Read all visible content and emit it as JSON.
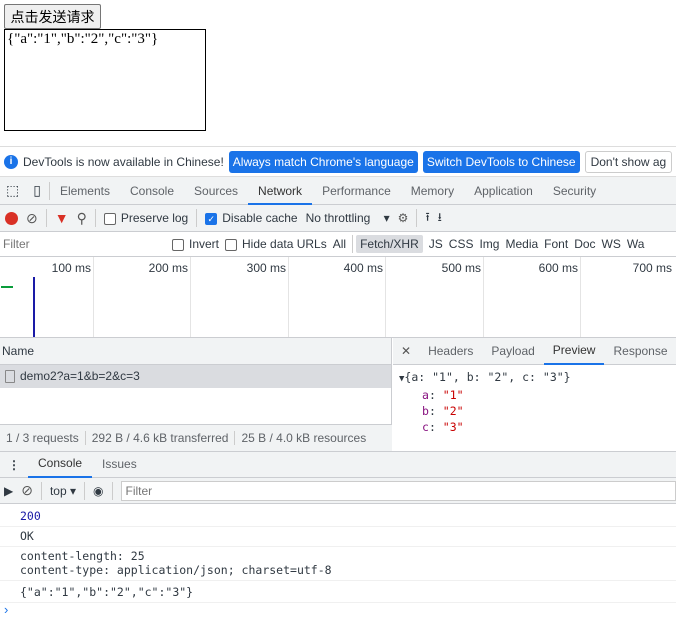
{
  "page": {
    "button_label": "点击发送请求",
    "output_text": "{\"a\":\"1\",\"b\":\"2\",\"c\":\"3\"}"
  },
  "infobar": {
    "message": "DevTools is now available in Chinese!",
    "btn_match": "Always match Chrome's language",
    "btn_switch": "Switch DevTools to Chinese",
    "btn_dont": "Don't show ag"
  },
  "tabs": [
    "Elements",
    "Console",
    "Sources",
    "Network",
    "Performance",
    "Memory",
    "Application",
    "Security"
  ],
  "active_tab": "Network",
  "toolbar": {
    "preserve_log": "Preserve log",
    "preserve_checked": false,
    "disable_cache": "Disable cache",
    "disable_checked": true,
    "throttling": "No throttling"
  },
  "filter": {
    "placeholder": "Filter",
    "invert": "Invert",
    "hide_data": "Hide data URLs",
    "types": [
      "All",
      "Fetch/XHR",
      "JS",
      "CSS",
      "Img",
      "Media",
      "Font",
      "Doc",
      "WS",
      "Wa"
    ],
    "active_type": "Fetch/XHR"
  },
  "timeline": {
    "ticks": [
      "100 ms",
      "200 ms",
      "300 ms",
      "400 ms",
      "500 ms",
      "600 ms",
      "700 ms"
    ]
  },
  "requests": {
    "header": "Name",
    "rows": [
      "demo2?a=1&b=2&c=3"
    ],
    "summary": [
      "1 / 3 requests",
      "292 B / 4.6 kB transferred",
      "25 B / 4.0 kB resources"
    ]
  },
  "detail": {
    "tabs": [
      "Headers",
      "Payload",
      "Preview",
      "Response"
    ],
    "active": "Preview",
    "summary": "{a: \"1\", b: \"2\", c: \"3\"}",
    "props": [
      {
        "k": "a",
        "v": "\"1\""
      },
      {
        "k": "b",
        "v": "\"2\""
      },
      {
        "k": "c",
        "v": "\"3\""
      }
    ]
  },
  "drawer": {
    "tabs": [
      "Console",
      "Issues"
    ],
    "context": "top",
    "filter_placeholder": "Filter"
  },
  "console": {
    "messages": [
      "200",
      "OK",
      "content-length: 25\ncontent-type: application/json; charset=utf-8",
      "{\"a\":\"1\",\"b\":\"2\",\"c\":\"3\"}"
    ],
    "status_color": "#1a1aa6"
  },
  "colors": {
    "accent": "#1a73e8",
    "record": "#d93025",
    "filter_icon": "#d93025"
  }
}
